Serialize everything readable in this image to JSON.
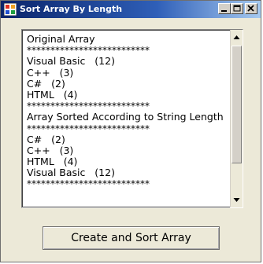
{
  "window": {
    "title": "Sort Array By Length",
    "controls": {
      "minimize_icon": "minimize-icon",
      "maximize_icon": "maximize-icon",
      "close_icon": "close-icon"
    },
    "app_icon": "application-icon"
  },
  "listbox": {
    "items": [
      "Original Array",
      "**************************",
      "Visual Basic   (12)",
      "C++   (3)",
      "C#   (2)",
      "HTML   (4)",
      "**************************",
      "Array Sorted According to String Length",
      "**************************",
      "C#   (2)",
      "C++   (3)",
      "HTML   (4)",
      "Visual Basic   (12)",
      "**************************"
    ],
    "scroll_up_icon": "scroll-up-arrow-icon",
    "scroll_down_icon": "scroll-down-arrow-icon"
  },
  "button": {
    "label": "Create and Sort Array"
  },
  "colors": {
    "titlebar_start": "#0a246a",
    "titlebar_end": "#a6caf0",
    "window_bg": "#ece9d8"
  }
}
